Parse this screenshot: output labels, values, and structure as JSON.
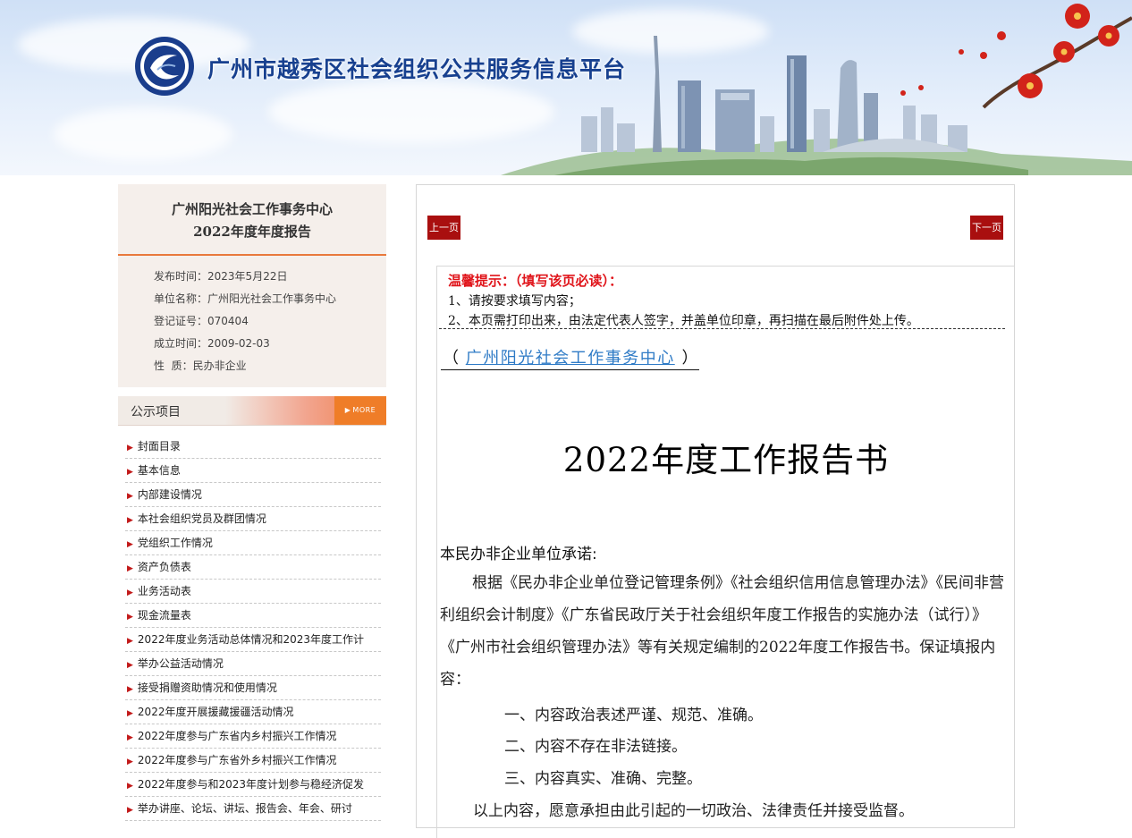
{
  "header": {
    "site_title": "广州市越秀区社会组织公共服务信息平台",
    "logo_icon": "social-organization-logo-icon",
    "accent_color": "#17408f"
  },
  "sidebar": {
    "org_name": "广州阳光社会工作事务中心",
    "report_year": "2022年度年度报告",
    "meta": [
      {
        "label": "发布时间：",
        "value": "2023年5月22日"
      },
      {
        "label": "单位名称：",
        "value": "广州阳光社会工作事务中心"
      },
      {
        "label": "登记证号：",
        "value": "070404"
      },
      {
        "label": "成立时间：",
        "value": "2009-02-03"
      },
      {
        "label": "性  质：",
        "value": "民办非企业"
      }
    ],
    "notice_label": "公示项目",
    "more_label": "MORE",
    "items": [
      {
        "label": "封面目录"
      },
      {
        "label": "基本信息"
      },
      {
        "label": "内部建设情况"
      },
      {
        "label": "本社会组织党员及群团情况"
      },
      {
        "label": "党组织工作情况"
      },
      {
        "label": "资产负债表"
      },
      {
        "label": "业务活动表"
      },
      {
        "label": "现金流量表"
      },
      {
        "label": "2022年度业务活动总体情况和2023年度工作计"
      },
      {
        "label": "举办公益活动情况"
      },
      {
        "label": "接受捐赠资助情况和使用情况"
      },
      {
        "label": "2022年度开展援藏援疆活动情况"
      },
      {
        "label": "2022年度参与广东省内乡村振兴工作情况"
      },
      {
        "label": "2022年度参与广东省外乡村振兴工作情况"
      },
      {
        "label": "2022年度参与和2023年度计划参与稳经济促发"
      },
      {
        "label": "举办讲座、论坛、讲坛、报告会、年会、研讨"
      }
    ],
    "bullet_icon": "triangle-bullet-icon"
  },
  "main": {
    "prev_label": "上一页",
    "next_label": "下一页",
    "tip": {
      "title": "温馨提示：（填写该页必读）：",
      "line1": "1、请按要求填写内容；",
      "line2": "2、本页需打印出来，由法定代表人签字，并盖单位印章，再扫描在最后附件处上传。"
    },
    "org_paren_open": "（",
    "org_inline": "广州阳光社会工作事务中心",
    "org_paren_close": "）",
    "report_title": "2022年度工作报告书",
    "commit_heading": "本民办非企业单位承诺:",
    "commit_body": "根据《民办非企业单位登记管理条例》《社会组织信用信息管理办法》《民间非营利组织会计制度》《广东省民政厅关于社会组织年度工作报告的实施办法（试行）》《广州市社会组织管理办法》等有关规定编制的2022年度工作报告书。保证填报内容：",
    "commit_items": [
      "一、内容政治表述严谨、规范、准确。",
      "二、内容不存在非法链接。",
      "三、内容真实、准确、完整。"
    ],
    "commit_final": "以上内容，愿意承担由此引起的一切政治、法律责任并接受监督。"
  }
}
